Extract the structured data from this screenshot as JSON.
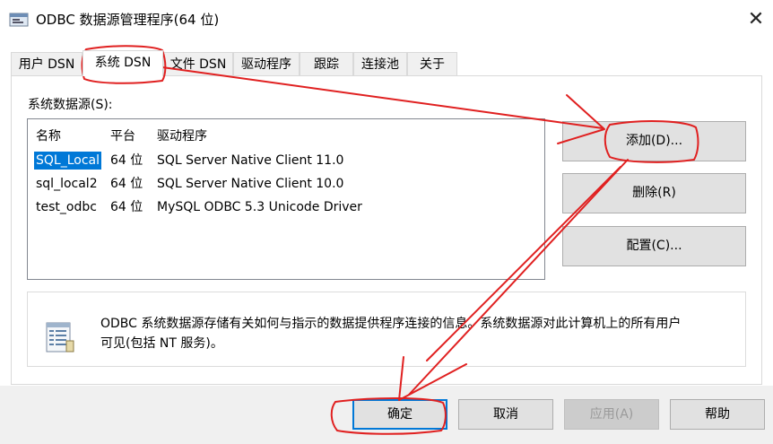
{
  "window": {
    "title": "ODBC 数据源管理程序(64 位)",
    "close_glyph": "✕"
  },
  "tabs": [
    {
      "label": "用户 DSN",
      "active": false
    },
    {
      "label": "系统 DSN",
      "active": true
    },
    {
      "label": "文件 DSN",
      "active": false
    },
    {
      "label": "驱动程序",
      "active": false
    },
    {
      "label": "跟踪",
      "active": false
    },
    {
      "label": "连接池",
      "active": false
    },
    {
      "label": "关于",
      "active": false
    }
  ],
  "system_ds": {
    "label": "系统数据源(S):",
    "columns": [
      "名称",
      "平台",
      "驱动程序"
    ],
    "rows": [
      {
        "name": "SQL_Local",
        "platform": "64 位",
        "driver": "SQL Server Native Client 11.0",
        "selected": true
      },
      {
        "name": "sql_local2",
        "platform": "64 位",
        "driver": "SQL Server Native Client 10.0",
        "selected": false
      },
      {
        "name": "test_odbc",
        "platform": "64 位",
        "driver": "MySQL ODBC 5.3 Unicode Driver",
        "selected": false
      }
    ]
  },
  "side_buttons": {
    "add": "添加(D)...",
    "remove": "删除(R)",
    "configure": "配置(C)..."
  },
  "info": {
    "line1": "ODBC 系统数据源存储有关如何与指示的数据提供程序连接的信息。系统数据源对此计算机上的所有用户",
    "line2": "可见(包括 NT 服务)。"
  },
  "footer": {
    "ok": "确定",
    "cancel": "取消",
    "apply": "应用(A)",
    "help": "帮助"
  },
  "colors": {
    "selection": "#0078d7",
    "annotation": "#e02020"
  },
  "icons": [
    "app-window-icon",
    "close-icon",
    "data-sources-info-icon"
  ]
}
